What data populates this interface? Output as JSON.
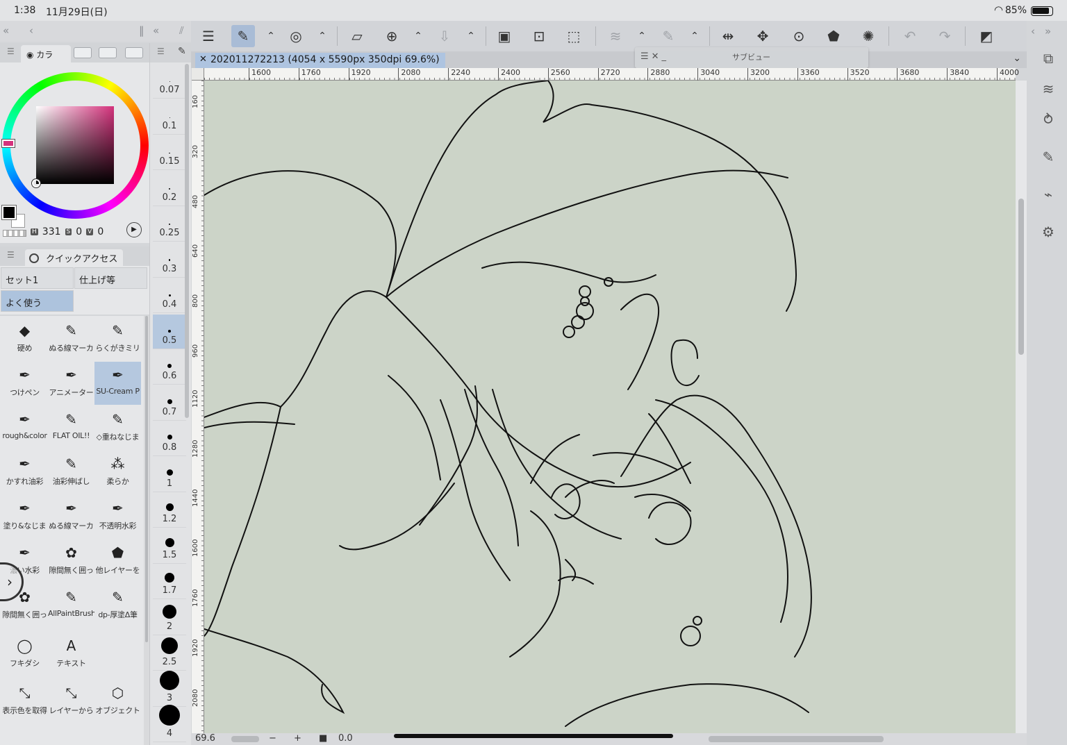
{
  "status_bar": {
    "time": "1:38",
    "date": "11月29日(日)",
    "battery": "85%"
  },
  "color_panel": {
    "tab_label": "カラ",
    "values": {
      "h_label": "H",
      "h": "331",
      "s_label": "S",
      "s": "0",
      "v_label": "V",
      "v": "0"
    },
    "colors": {
      "main": "#000000",
      "sub": "#ffffff",
      "hue": "#d4327c",
      "selection": "#adc3dd"
    }
  },
  "quick_access": {
    "title": "クイックアクセス",
    "sets": [
      "セット1",
      "仕上げ等",
      "よく使う"
    ],
    "tools": [
      {
        "label": "硬め",
        "icon": "eraser-icon",
        "glyph": "◆"
      },
      {
        "label": "ぬる線マーカ",
        "icon": "marker-icon",
        "glyph": "✎"
      },
      {
        "label": "らくがきミリ",
        "icon": "marker-icon",
        "glyph": "✎"
      },
      {
        "label": "つけペン",
        "icon": "pen-nib-icon",
        "glyph": "✒"
      },
      {
        "label": "アニメーター",
        "icon": "pen-nib-icon",
        "glyph": "✒"
      },
      {
        "label": "SU-Cream P",
        "icon": "pen-nib-icon",
        "glyph": "✒"
      },
      {
        "label": "rough&color",
        "icon": "pen-nib-icon",
        "glyph": "✒"
      },
      {
        "label": "FLAT OIL!!",
        "icon": "brush-icon",
        "glyph": "✎"
      },
      {
        "label": "◇重ねなじま",
        "icon": "brush-icon",
        "glyph": "✎"
      },
      {
        "label": "かすれ油彩",
        "icon": "brush-icon",
        "glyph": "✒"
      },
      {
        "label": "油彩伸ばし",
        "icon": "brush-icon",
        "glyph": "✎"
      },
      {
        "label": "柔らか",
        "icon": "airbrush-icon",
        "glyph": "⁂"
      },
      {
        "label": "塗り&なじま",
        "icon": "pen-nib-icon",
        "glyph": "✒"
      },
      {
        "label": "ぬる線マーカ",
        "icon": "pen-nib-icon",
        "glyph": "✒"
      },
      {
        "label": "不透明水彩",
        "icon": "pen-nib-icon",
        "glyph": "✒"
      },
      {
        "label": "濃い水彩",
        "icon": "pen-nib-icon",
        "glyph": "✒"
      },
      {
        "label": "隙間無く囲っ",
        "icon": "lasso-fill-icon",
        "glyph": "✿"
      },
      {
        "label": "他レイヤーを",
        "icon": "bucket-icon",
        "glyph": "⬟"
      },
      {
        "label": "隙間無く囲っ",
        "icon": "lasso-fill-icon",
        "glyph": "✿"
      },
      {
        "label": "AllPaintBrush",
        "icon": "brush-icon",
        "glyph": "✎"
      },
      {
        "label": "dp-厚塗Δ筆",
        "icon": "brush-icon",
        "glyph": "✎"
      },
      {
        "label": "フキダシ",
        "icon": "speech-balloon-icon",
        "glyph": "◯"
      },
      {
        "label": "テキスト",
        "icon": "text-icon",
        "glyph": "A"
      },
      {
        "label": "表示色を取得",
        "icon": "eyedropper-icon",
        "glyph": "⤡"
      },
      {
        "label": "レイヤーから",
        "icon": "eyedropper-icon",
        "glyph": "⤡"
      },
      {
        "label": "オブジェクト",
        "icon": "object-select-icon",
        "glyph": "⬡"
      }
    ]
  },
  "brush_sizes": [
    "0.07",
    "0.1",
    "0.15",
    "0.2",
    "0.25",
    "0.3",
    "0.4",
    "0.5",
    "0.6",
    "0.7",
    "0.8",
    "1",
    "1.2",
    "1.5",
    "1.7",
    "2",
    "2.5",
    "3",
    "4"
  ],
  "document": {
    "tab_title": "202011272213 (4054 x 5590px 350dpi 69.6%)",
    "subview_title": "サブビュー"
  },
  "ruler": {
    "h_ticks": [
      "1600",
      "1760",
      "1920",
      "2080",
      "2240",
      "2400",
      "2560",
      "2720",
      "2880",
      "3040",
      "3200",
      "3360",
      "3520",
      "3680",
      "3840",
      "4000"
    ],
    "v_ticks": [
      "160",
      "320",
      "480",
      "640",
      "800",
      "960",
      "1120",
      "1280",
      "1440",
      "1600",
      "1760",
      "1920",
      "2080"
    ]
  },
  "bottom_bar": {
    "zoom": "69.6",
    "minus": "−",
    "plus": "+",
    "rotation": "0.0"
  },
  "canvas_colors": {
    "paper": "#ccd4c8",
    "line": "#111111"
  }
}
